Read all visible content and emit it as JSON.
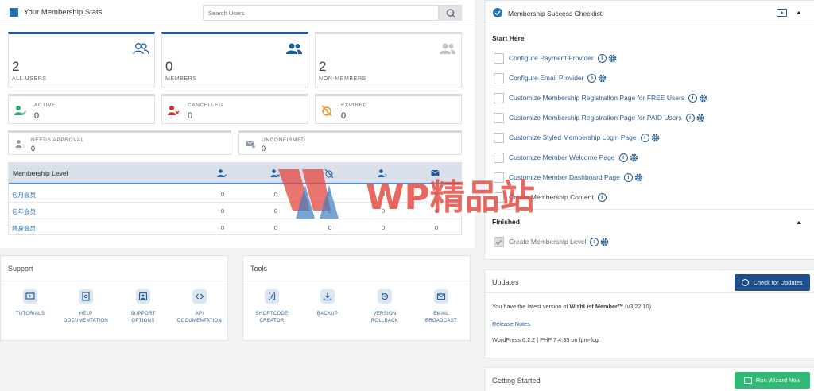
{
  "stats": {
    "title": "Your Membership Stats",
    "search_placeholder": "Search Users",
    "cards": [
      {
        "value": "2",
        "label": "ALL USERS"
      },
      {
        "value": "0",
        "label": "MEMBERS"
      },
      {
        "value": "2",
        "label": "NON-MEMBERS"
      }
    ],
    "status": [
      {
        "label": "ACTIVE",
        "value": "0",
        "icon": "user-check-icon"
      },
      {
        "label": "CANCELLED",
        "value": "0",
        "icon": "user-x-icon"
      },
      {
        "label": "EXPIRED",
        "value": "0",
        "icon": "clock-off-icon"
      }
    ],
    "pending": [
      {
        "label": "NEEDS APPROVAL",
        "value": "0",
        "icon": "user-question-icon"
      },
      {
        "label": "UNCONFIRMED",
        "value": "0",
        "icon": "mail-check-icon"
      }
    ],
    "levels": {
      "header": "Membership Level",
      "rows": [
        {
          "name": "包月会员",
          "values": [
            "0",
            "0",
            "0",
            "0",
            "0"
          ]
        },
        {
          "name": "包年会员",
          "values": [
            "0",
            "0",
            "0",
            "0",
            "0"
          ]
        },
        {
          "name": "终身会员",
          "values": [
            "0",
            "0",
            "0",
            "0",
            "0"
          ]
        }
      ]
    }
  },
  "support": {
    "title": "Support",
    "items": [
      {
        "label1": "TUTORIALS",
        "label2": "",
        "icon": "video-icon"
      },
      {
        "label1": "HELP",
        "label2": "DOCUMENTATION",
        "icon": "help-doc-icon"
      },
      {
        "label1": "SUPPORT",
        "label2": "OPTIONS",
        "icon": "support-icon"
      },
      {
        "label1": "API",
        "label2": "DOCUMENTATION",
        "icon": "code-icon"
      }
    ]
  },
  "tools": {
    "title": "Tools",
    "items": [
      {
        "label1": "SHORTCODE",
        "label2": "CREATOR",
        "icon": "shortcode-icon"
      },
      {
        "label1": "BACKUP",
        "label2": "",
        "icon": "backup-icon"
      },
      {
        "label1": "VERSION",
        "label2": "ROLLBACK",
        "icon": "rollback-icon"
      },
      {
        "label1": "EMAIL",
        "label2": "BROADCAST",
        "icon": "email-icon"
      }
    ]
  },
  "checklist": {
    "title": "Membership Success Checklist",
    "start_section": "Start Here",
    "items": [
      {
        "text": "Configure Payment Provider",
        "gear": true
      },
      {
        "text": "Configure Email Provider",
        "gear": true
      },
      {
        "text": "Customize Membership Registration Page for FREE Users",
        "gear": true
      },
      {
        "text": "Customize Membership Registration Page for PAID Users",
        "gear": true
      },
      {
        "text": "Customize Styled Membership Login Page",
        "gear": true
      },
      {
        "text": "Customize Member Welcome Page",
        "gear": true
      },
      {
        "text": "Customize Member Dashboard Page",
        "gear": true
      },
      {
        "text": "Create Membership Content",
        "gear": false
      }
    ],
    "finished_section": "Finished",
    "finished_items": [
      {
        "text": "Create Membership Level",
        "gear": true
      }
    ]
  },
  "updates": {
    "title": "Updates",
    "button": "Check for Updates",
    "latest_prefix": "You have the latest version of ",
    "product": "WishList Member™",
    "version": " (v3.22.10)",
    "release_notes": "Release Notes",
    "env": "WordPress 6.2.2 | PHP 7.4.33 on fpm-fcgi"
  },
  "getting_started": {
    "title": "Getting Started",
    "button": "Run Wizard Now"
  },
  "watermark": {
    "text": "WP精品站"
  },
  "colors": {
    "accent": "#1e5a9c",
    "link": "#2c5f93",
    "success": "#2fbb76",
    "watermark_red": "#e0473d",
    "watermark_blue": "#3d7fc1"
  }
}
